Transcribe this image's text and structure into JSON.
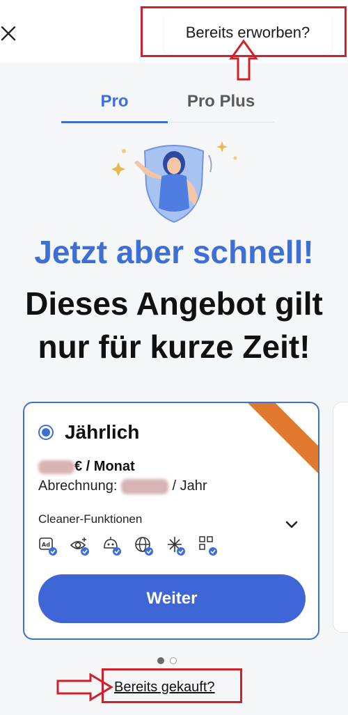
{
  "header": {
    "close_icon": "close-icon",
    "already_purchased_label": "Bereits erworben?"
  },
  "tabs": [
    {
      "label": "Pro",
      "active": true
    },
    {
      "label": "Pro Plus",
      "active": false
    }
  ],
  "hero": {
    "headline_accent": "Jetzt aber schnell!",
    "headline_line1": "Dieses Angebot gilt",
    "headline_line2": "nur für kurze Zeit!"
  },
  "plan": {
    "name": "Jährlich",
    "price_suffix": "€ / Monat",
    "billing_prefix": "Abrechnung:",
    "billing_suffix": "/ Jahr",
    "features_label": "Cleaner-Funktionen",
    "feature_icons": [
      "ad-block-icon",
      "privacy-eye-icon",
      "robot-icon",
      "globe-icon",
      "snowflake-icon",
      "qr-code-icon"
    ],
    "cta_label": "Weiter"
  },
  "pagination": {
    "count": 2,
    "active_index": 0
  },
  "footer": {
    "already_bought_label": "Bereits gekauft?"
  },
  "colors": {
    "accent": "#3e6fd6",
    "cta": "#3e66d6",
    "annotation": "#d0202a",
    "ribbon": "#e0782e"
  }
}
